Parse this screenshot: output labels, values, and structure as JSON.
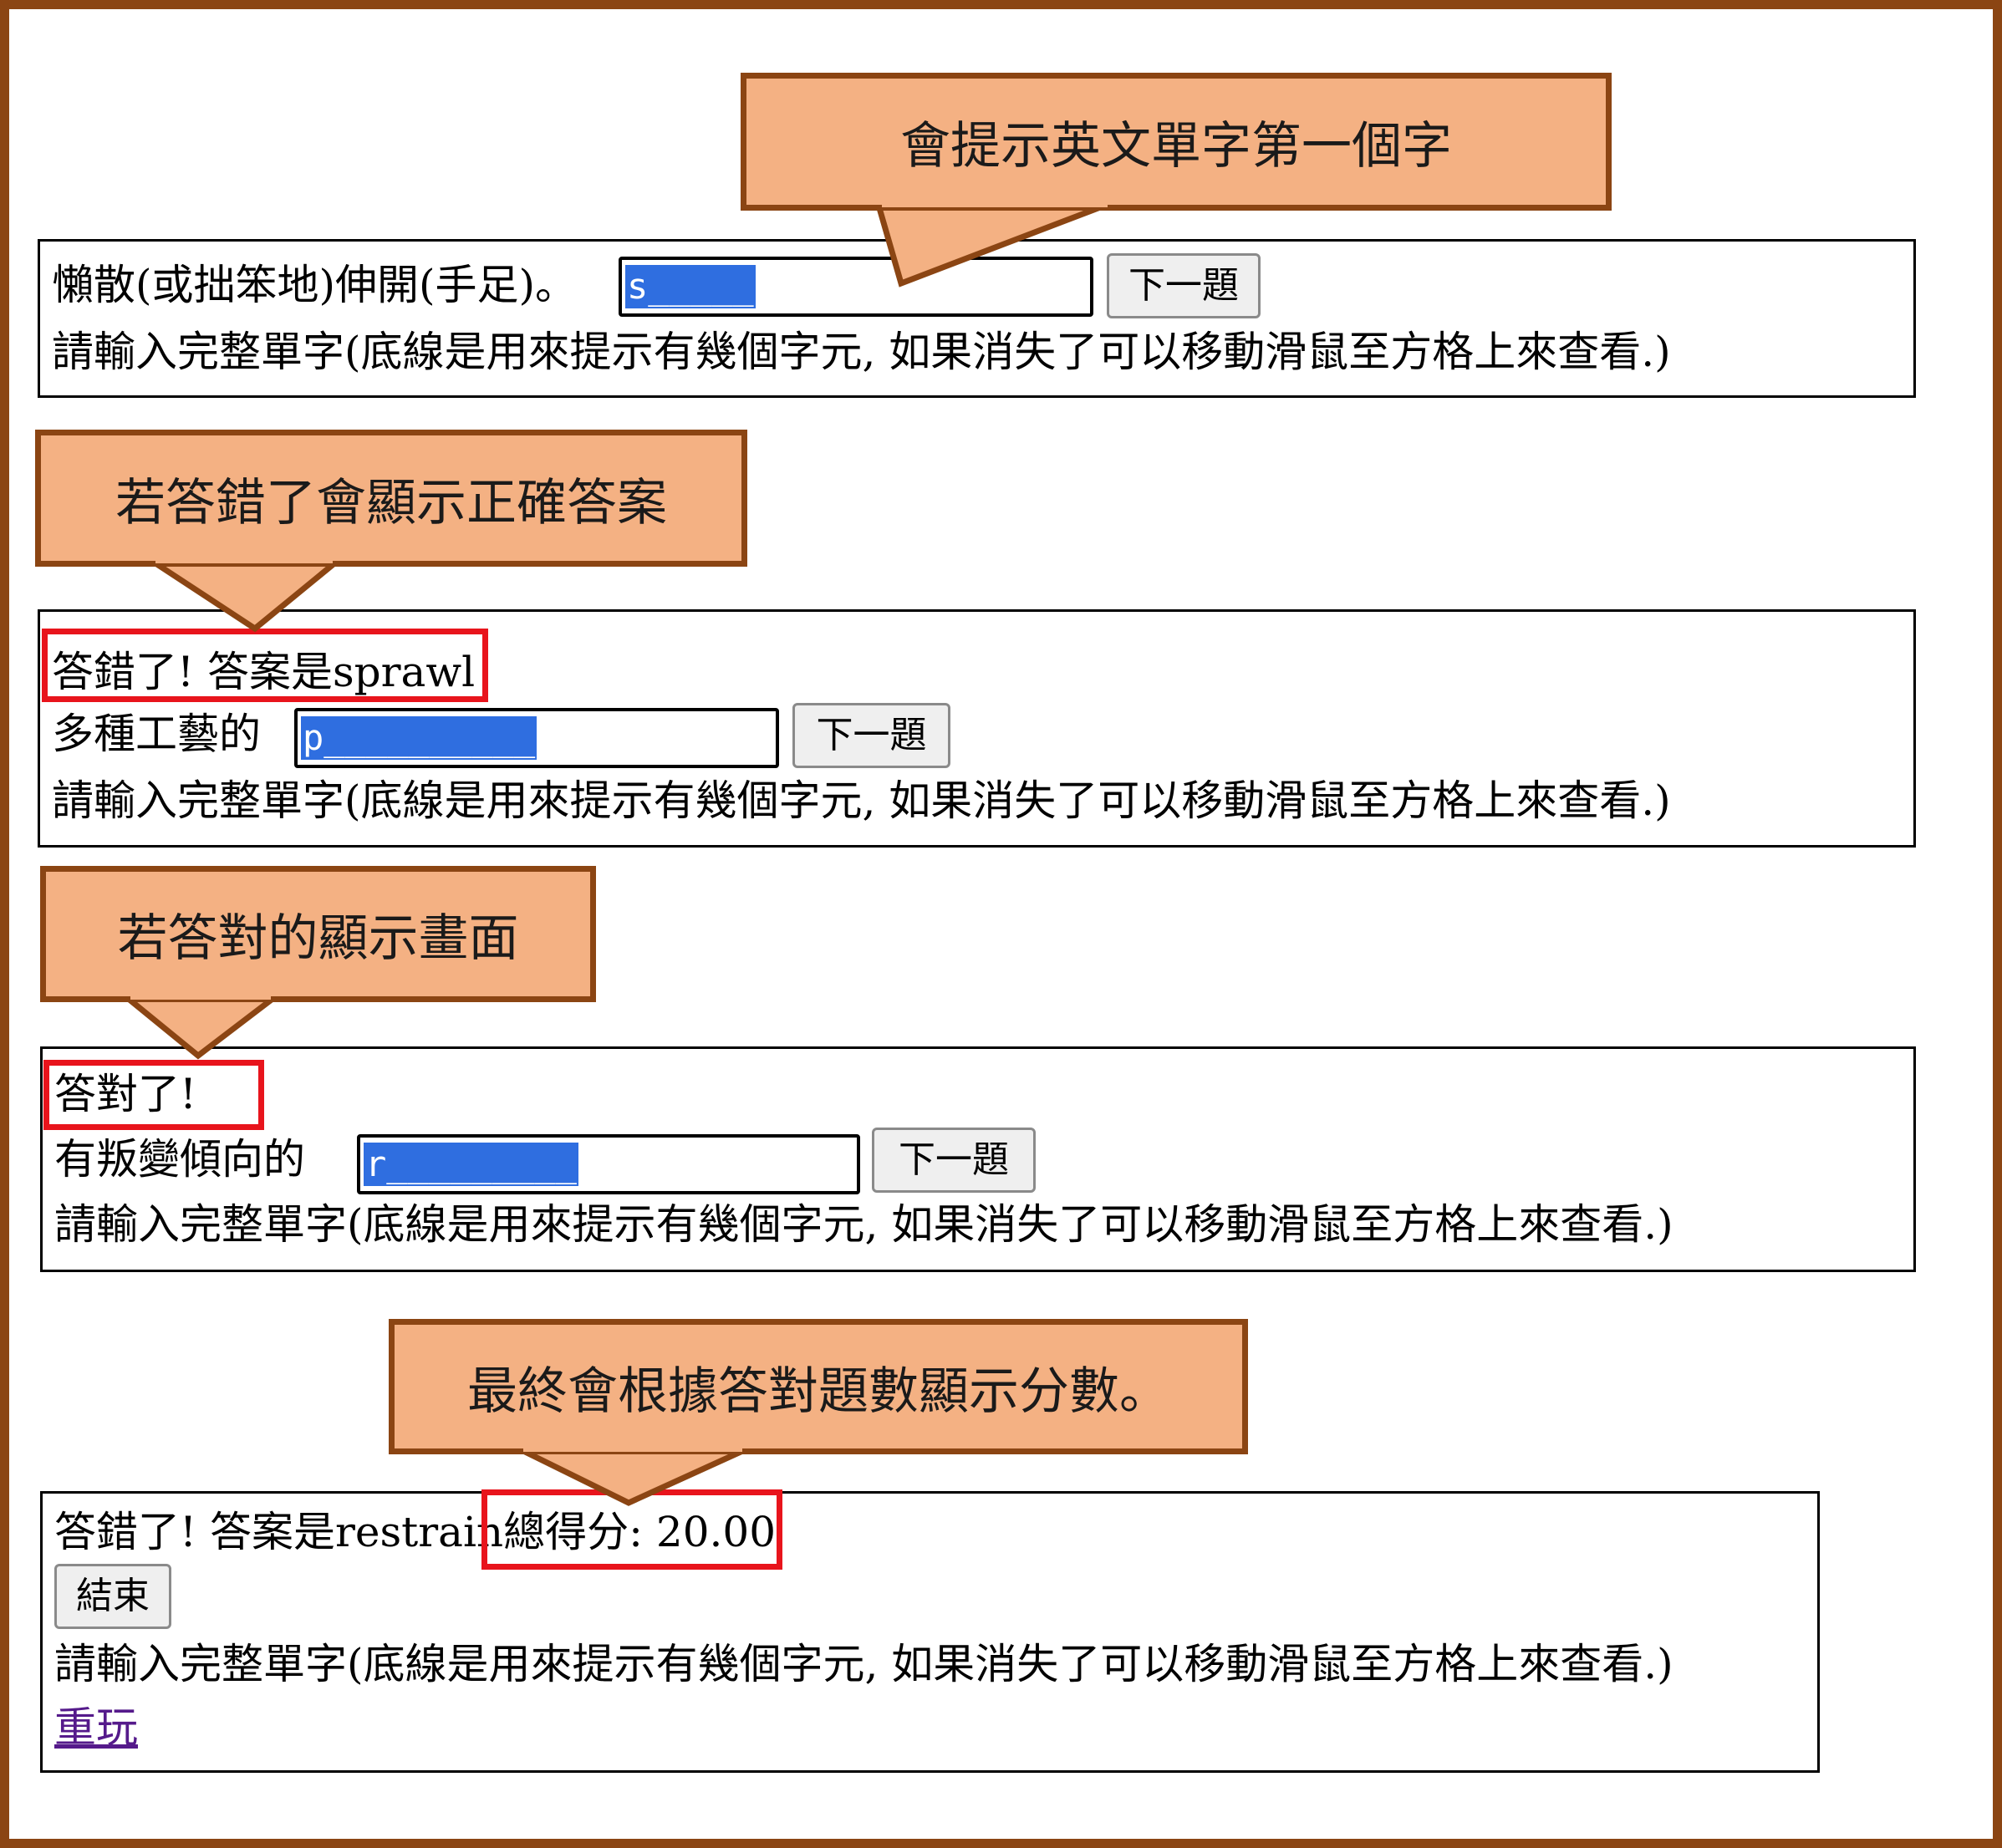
{
  "colors": {
    "frame": "#8b4513",
    "callout_fill": "#f4b183",
    "highlight": "#e8141c",
    "selection": "#2f6ee0",
    "visited_link": "#551a8b"
  },
  "callouts": {
    "hint": "會提示英文單字第一個字",
    "wrong": "若答錯了會顯示正確答案",
    "right": "若答對的顯示畫面",
    "score": "最終會根據答對題數顯示分數。"
  },
  "q1": {
    "question": "懶散(或拙笨地)伸開(手足)。",
    "input_value": "s_____",
    "next_label": "下一題",
    "instruction": "請輸入完整單字(底線是用來提示有幾個字元, 如果消失了可以移動滑鼠至方格上來查看.)"
  },
  "q2": {
    "feedback": "答錯了! 答案是sprawl",
    "question": "多種工藝的",
    "input_value": "p__________",
    "next_label": "下一題",
    "instruction": "請輸入完整單字(底線是用來提示有幾個字元, 如果消失了可以移動滑鼠至方格上來查看.)"
  },
  "q3": {
    "feedback": "答對了!",
    "question": "有叛變傾向的",
    "input_value": "r_________",
    "next_label": "下一題",
    "instruction": "請輸入完整單字(底線是用來提示有幾個字元, 如果消失了可以移動滑鼠至方格上來查看.)"
  },
  "final": {
    "feedback": "答錯了! 答案是restrain",
    "score_text": "總得分: 20.00",
    "end_label": "結束",
    "instruction": "請輸入完整單字(底線是用來提示有幾個字元, 如果消失了可以移動滑鼠至方格上來查看.)",
    "replay_link": "重玩"
  }
}
